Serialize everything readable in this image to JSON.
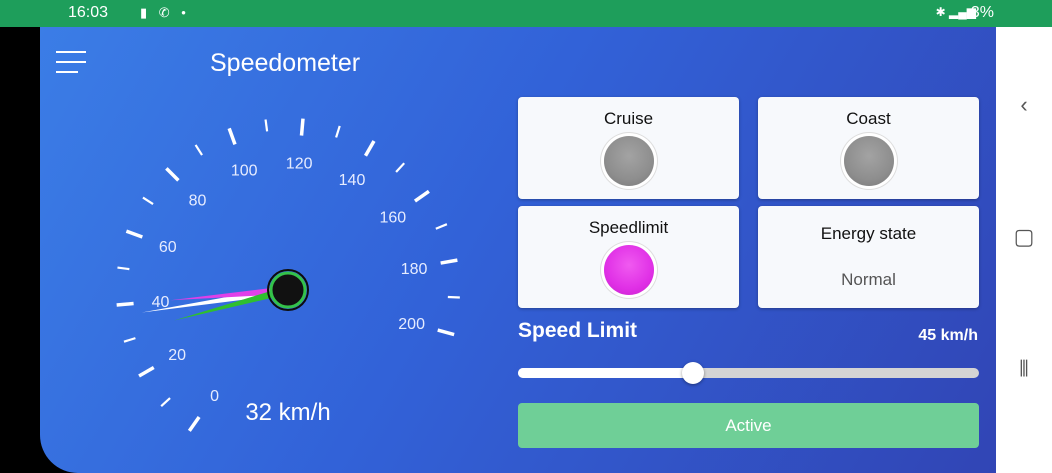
{
  "status_bar": {
    "time": "16:03",
    "battery": "3%"
  },
  "header": {
    "title": "Speedometer"
  },
  "gauge": {
    "min": 0,
    "max": 200,
    "tick_labels": [
      "0",
      "20",
      "40",
      "60",
      "80",
      "100",
      "120",
      "140",
      "160",
      "180",
      "200"
    ],
    "current_speed": 32,
    "speed_limit_needle": 40,
    "speed_text": "32 km/h",
    "colors": {
      "current_needle": "#2fbf2f",
      "limit_needle": "#e040e8",
      "ring": "#34c24a"
    }
  },
  "tiles": {
    "cruise": {
      "label": "Cruise",
      "state": "off"
    },
    "coast": {
      "label": "Coast",
      "state": "off"
    },
    "speedlimit": {
      "label": "Speedlimit",
      "state": "on"
    },
    "energy": {
      "label": "Energy state",
      "value": "Normal"
    }
  },
  "speed_limit": {
    "title": "Speed Limit",
    "value_text": "45 km/h",
    "fraction": 0.38
  },
  "active_button": {
    "label": "Active",
    "color": "#6fcf97"
  }
}
